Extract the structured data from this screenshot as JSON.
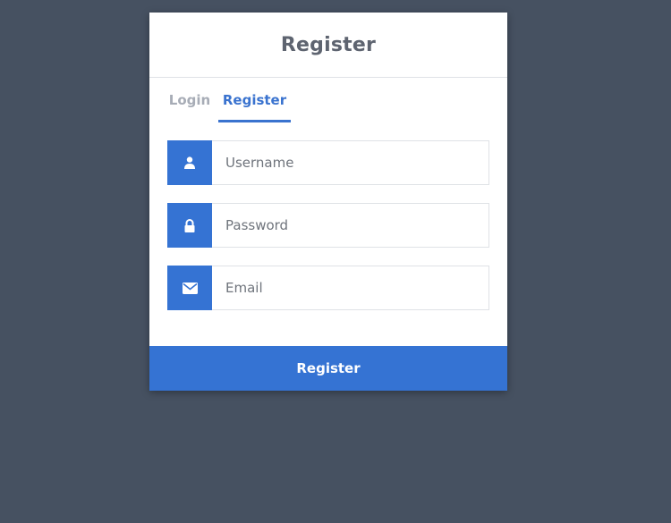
{
  "header": {
    "title": "Register"
  },
  "tabs": [
    {
      "label": "Login",
      "active": false
    },
    {
      "label": "Register",
      "active": true
    }
  ],
  "form": {
    "fields": [
      {
        "icon": "user-icon",
        "placeholder": "Username",
        "value": ""
      },
      {
        "icon": "lock-icon",
        "placeholder": "Password",
        "value": ""
      },
      {
        "icon": "envelope-icon",
        "placeholder": "Email",
        "value": ""
      }
    ],
    "submit_label": "Register"
  },
  "colors": {
    "background": "#465161",
    "accent": "#3573d3",
    "title": "#5e6470",
    "tab_inactive": "#a7acb6"
  }
}
